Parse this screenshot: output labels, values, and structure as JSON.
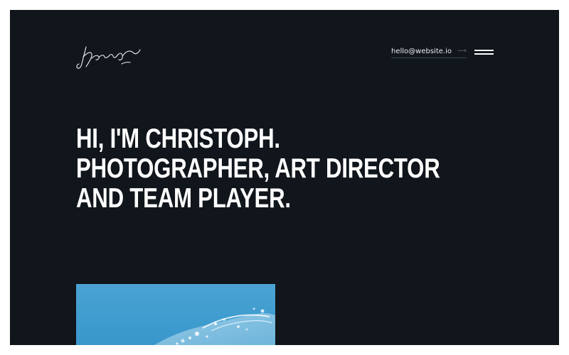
{
  "header": {
    "email": "hello@website.io",
    "email_icon": "arrow-right-icon",
    "menu_icon": "hamburger-menu-icon",
    "logo_icon": "signature-logo-icon"
  },
  "hero": {
    "lines": [
      "Hi, I'm Christoph.",
      "Photographer, art director",
      "and team player."
    ]
  },
  "featured_image": {
    "subject": "water-splash"
  },
  "colors": {
    "background": "#11161c",
    "text": "#ffffff",
    "image_sky": "#45a0d1"
  }
}
